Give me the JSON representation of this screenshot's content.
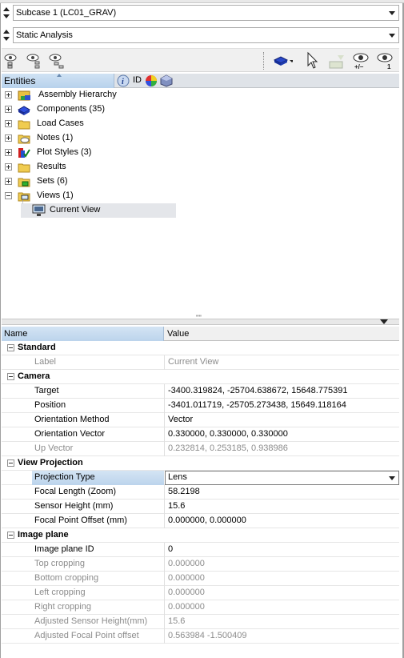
{
  "subcase_combo": {
    "value": "Subcase 1 (LC01_GRAV)"
  },
  "analysis_combo": {
    "value": "Static Analysis"
  },
  "toolbar": {
    "show_hide_label": "+/–",
    "isolate_label": "1"
  },
  "tree_header": {
    "entities_label": "Entities",
    "id_label": "ID"
  },
  "tree": {
    "items": [
      {
        "label": "Assembly Hierarchy",
        "icon": "assembly-hierarchy-icon"
      },
      {
        "label": "Components (35)",
        "icon": "components-icon"
      },
      {
        "label": "Load Cases",
        "icon": "folder-icon"
      },
      {
        "label": "Notes (1)",
        "icon": "notes-icon"
      },
      {
        "label": "Plot Styles (3)",
        "icon": "plot-styles-icon"
      },
      {
        "label": "Results",
        "icon": "folder-icon"
      },
      {
        "label": "Sets  (6)",
        "icon": "sets-icon"
      },
      {
        "label": "Views (1)",
        "icon": "views-icon"
      }
    ],
    "child": {
      "label": "Current View",
      "icon": "view-icon"
    }
  },
  "grid_header": {
    "name": "Name",
    "value": "Value"
  },
  "properties": {
    "standard": {
      "title": "Standard",
      "label_name": "Label",
      "label_value": "Current View"
    },
    "camera": {
      "title": "Camera",
      "rows": [
        {
          "name": "Target",
          "value": "-3400.319824, -25704.638672, 15648.775391"
        },
        {
          "name": "Position",
          "value": "-3401.011719, -25705.273438, 15649.118164"
        },
        {
          "name": "Orientation Method",
          "value": "Vector"
        },
        {
          "name": "Orientation Vector",
          "value": "0.330000, 0.330000, 0.330000"
        },
        {
          "name": "Up Vector",
          "value": "0.232814, 0.253185, 0.938986"
        }
      ]
    },
    "view_projection": {
      "title": "View Projection",
      "rows": [
        {
          "name": "Projection Type",
          "value": "Lens"
        },
        {
          "name": "Focal Length (Zoom)",
          "value": "58.2198"
        },
        {
          "name": "Sensor Height (mm)",
          "value": "15.6"
        },
        {
          "name": "Focal Point Offset (mm)",
          "value": "0.000000, 0.000000"
        }
      ]
    },
    "image_plane": {
      "title": "Image plane",
      "rows": [
        {
          "name": "Image plane ID",
          "value": "0"
        },
        {
          "name": "Top cropping",
          "value": "0.000000"
        },
        {
          "name": "Bottom cropping",
          "value": "0.000000"
        },
        {
          "name": "Left cropping",
          "value": "0.000000"
        },
        {
          "name": "Right cropping",
          "value": "0.000000"
        },
        {
          "name": "Adjusted Sensor Height(mm)",
          "value": "15.6"
        },
        {
          "name": "Adjusted Focal Point offset",
          "value": "0.563984 -1.500409"
        }
      ]
    }
  },
  "colors": {
    "header_blue": "#bcd4ec",
    "row_highlight": "#e4e6ea",
    "muted_text": "#8c8c8c"
  }
}
